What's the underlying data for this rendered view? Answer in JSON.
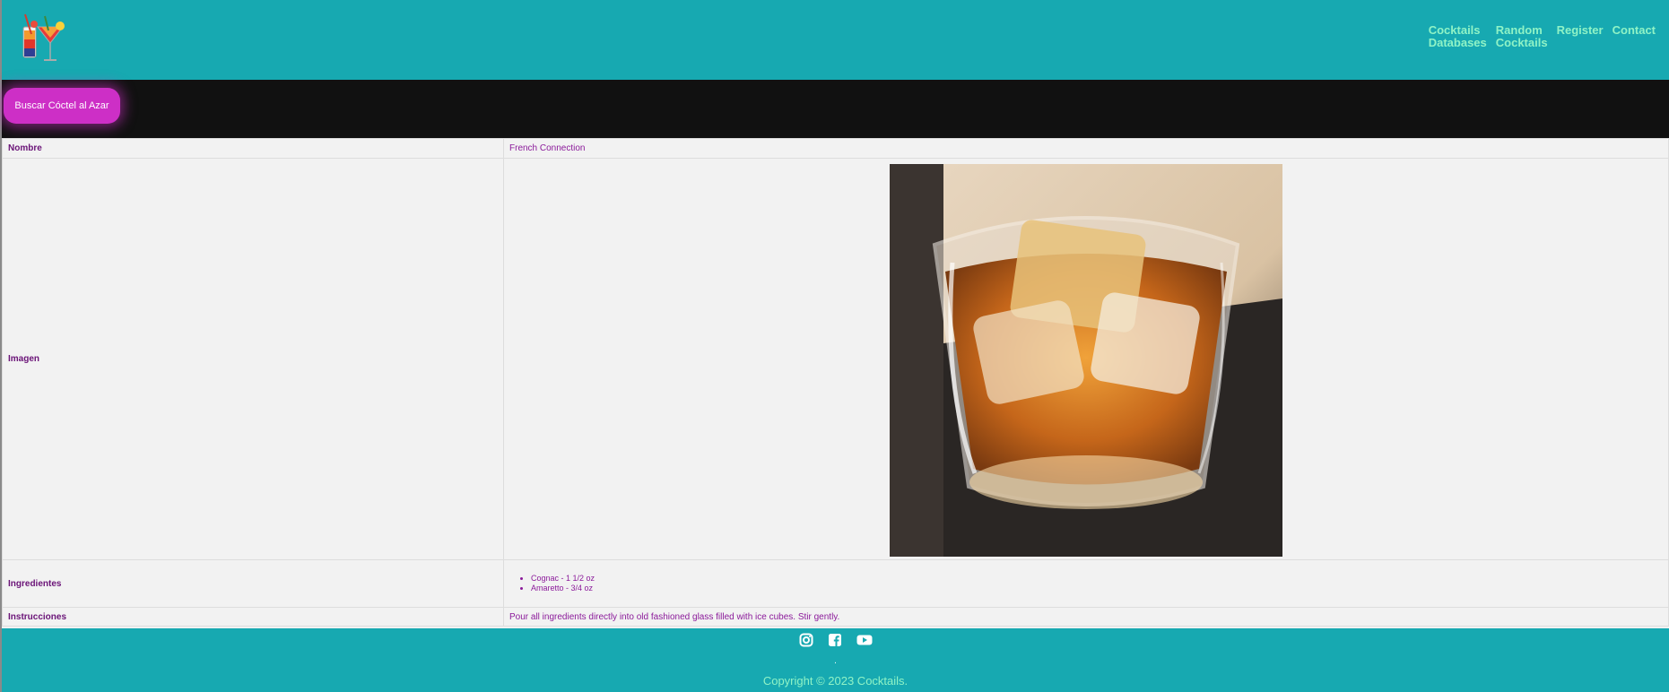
{
  "nav": {
    "items": [
      {
        "label": "Cocktails\nDatabases"
      },
      {
        "label": "Random\nCocktails"
      },
      {
        "label": "Register"
      },
      {
        "label": "Contact"
      }
    ]
  },
  "random_button": {
    "label": "Buscar Cóctel al Azar"
  },
  "table": {
    "name_label": "Nombre",
    "name_value": "French Connection",
    "image_label": "Imagen",
    "ingredients_label": "Ingredientes",
    "ingredients": [
      "Cognac - 1 1/2 oz",
      "Amaretto - 3/4 oz"
    ],
    "instructions_label": "Instrucciones",
    "instructions_value": "Pour all ingredients directly into old fashioned glass filled with ice cubes. Stir gently."
  },
  "footer": {
    "icons": [
      "instagram-icon",
      "facebook-icon",
      "youtube-icon"
    ],
    "dot": ".",
    "copyright": "Copyright © 2023 Cocktails."
  },
  "colors": {
    "header_bg": "#17a9b1",
    "nav_text": "#8ff3c6",
    "band_bg": "#111111",
    "button_bg": "#cd2fc6",
    "table_bg": "#f2f2f2",
    "table_text": "#8b1a9a"
  }
}
